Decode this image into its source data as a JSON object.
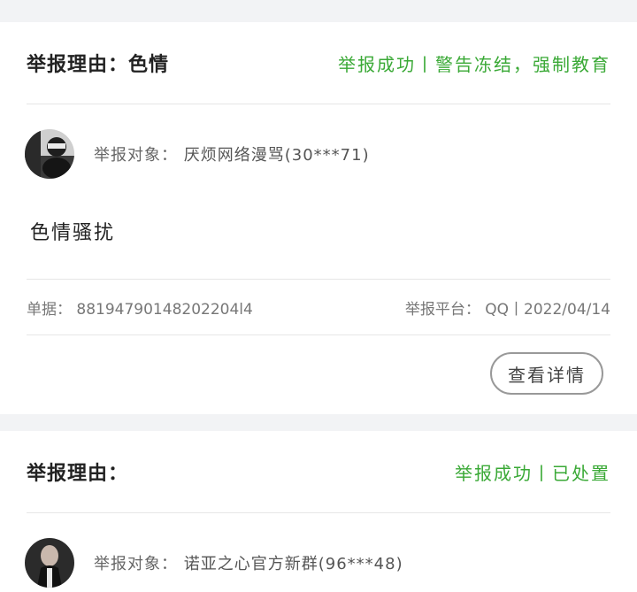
{
  "reports": [
    {
      "reason_label": "举报理由：",
      "reason_value": "色情",
      "status": "举报成功丨警告冻结，强制教育",
      "target_label": "举报对象：",
      "target_value": "厌烦网络漫骂(30***71)",
      "description": "色情骚扰",
      "ticket_label": "单据：",
      "ticket_value": "88194790148202204l4",
      "platform_label": "举报平台：",
      "platform_value": "QQ丨2022/04/14",
      "detail_button": "查看详情"
    },
    {
      "reason_label": "举报理由：",
      "reason_value": "",
      "status": "举报成功丨已处置",
      "target_label": "举报对象：",
      "target_value": "诺亚之心官方新群(96***48)"
    }
  ],
  "colors": {
    "status_green": "#3aa936",
    "background": "#f2f3f5"
  },
  "icons": {
    "avatar_1": "avatar-photo",
    "avatar_2": "avatar-photo"
  }
}
